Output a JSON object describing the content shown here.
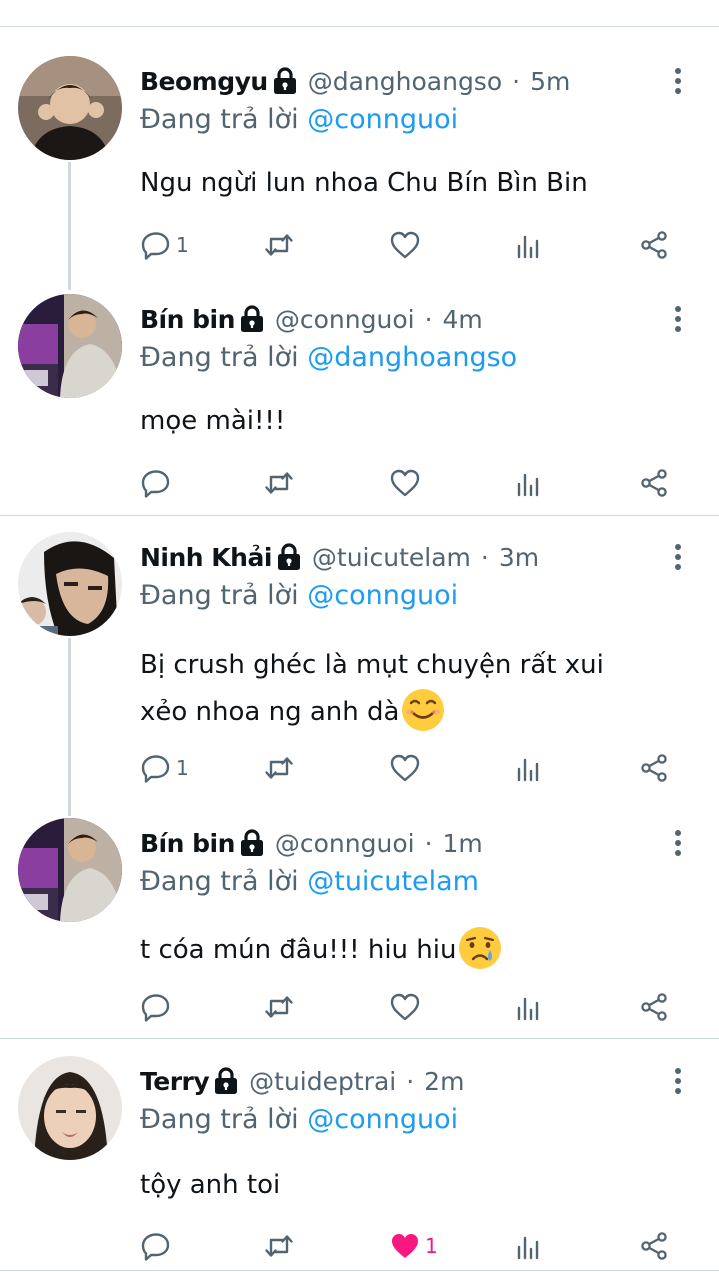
{
  "tweets": [
    {
      "name": "Beomgyu",
      "handle": "@danghoangso",
      "time": "5m",
      "replying_label": "Đang trả lời",
      "replying_to": "@connguoi",
      "text_lines": [
        "Ngu ngừi lun nhoa Chu Bín Bìn Bin"
      ],
      "reply_count": "1",
      "like_count": "",
      "liked": false
    },
    {
      "name": "Bín bin",
      "handle": "@connguoi",
      "time": "4m",
      "replying_label": "Đang trả lời",
      "replying_to": "@danghoangso",
      "text_lines": [
        "mọe mài!!!"
      ],
      "reply_count": "",
      "like_count": "",
      "liked": false
    },
    {
      "name": "Ninh Khải",
      "handle": "@tuicutelam",
      "time": "3m",
      "replying_label": "Đang trả lời",
      "replying_to": "@connguoi",
      "text_lines": [
        "Bị crush ghéc là mụt chuyện rất xui",
        "xẻo nhoa ng anh dà"
      ],
      "emoji": "smiling-face-emoji",
      "reply_count": "1",
      "like_count": "",
      "liked": false
    },
    {
      "name": "Bín bin",
      "handle": "@connguoi",
      "time": "1m",
      "replying_label": "Đang trả lời",
      "replying_to": "@tuicutelam",
      "text_lines": [
        "t cóa mún đâu!!! hiu hiu"
      ],
      "emoji": "crying-face-emoji",
      "reply_count": "",
      "like_count": "",
      "liked": false
    },
    {
      "name": "Terry",
      "handle": "@tuideptrai",
      "time": "2m",
      "replying_label": "Đang trả lời",
      "replying_to": "@connguoi",
      "text_lines": [
        "tộy anh toi"
      ],
      "reply_count": "",
      "like_count": "1",
      "liked": true
    }
  ],
  "icons": [
    "lock-icon",
    "more-icon",
    "reply-icon",
    "retweet-icon",
    "like-icon",
    "views-icon",
    "share-icon"
  ],
  "colors": {
    "accent": "#1d9bf0",
    "muted": "#536471",
    "like": "#f91880",
    "divider": "#cfd9de"
  }
}
